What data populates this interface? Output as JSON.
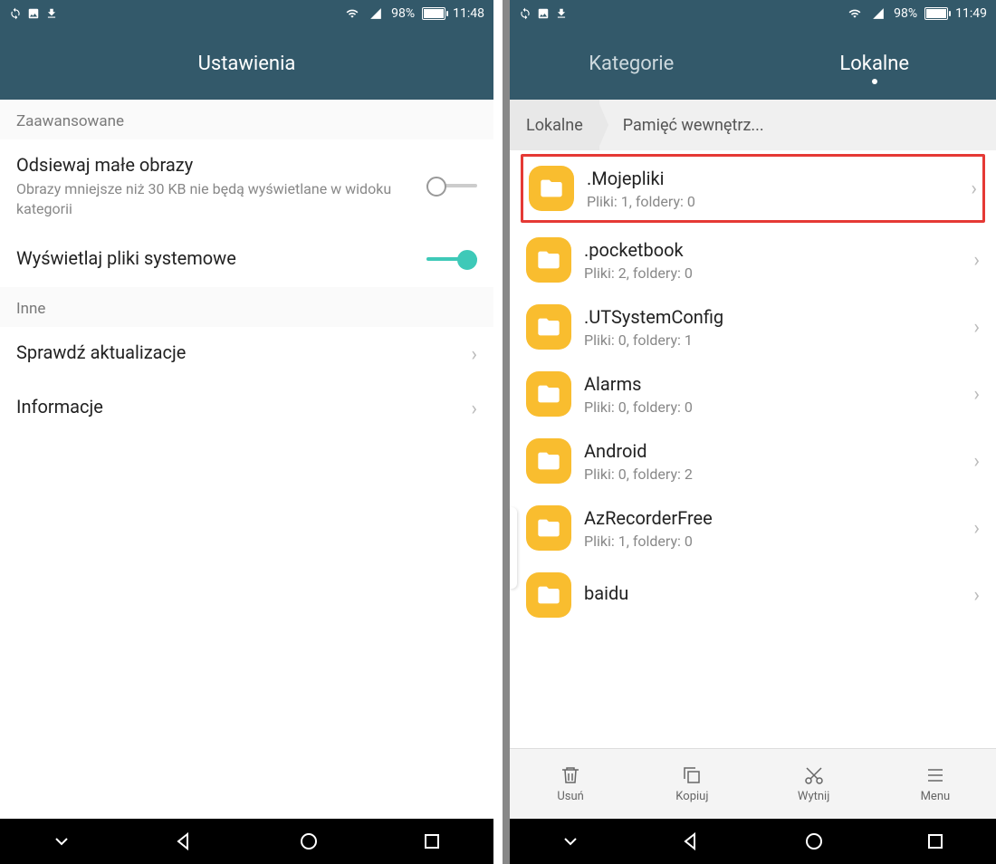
{
  "left": {
    "status": {
      "battery": "98%",
      "time": "11:48"
    },
    "title": "Ustawienia",
    "sections": {
      "advanced_header": "Zaawansowane",
      "filter_small": {
        "title": "Odsiewaj małe obrazy",
        "sub": "Obrazy mniejsze niż 30 KB nie będą wyświetlane w widoku kategorii",
        "value": false
      },
      "show_system": {
        "title": "Wyświetlaj pliki systemowe",
        "value": true
      },
      "other_header": "Inne",
      "check_updates": "Sprawdź aktualizacje",
      "info": "Informacje"
    }
  },
  "right": {
    "status": {
      "battery": "98%",
      "time": "11:49"
    },
    "tabs": {
      "categories": "Kategorie",
      "local": "Lokalne"
    },
    "breadcrumb": {
      "a": "Lokalne",
      "b": "Pamięć wewnętrz..."
    },
    "folders": [
      {
        "name": ".Mojepliki",
        "sub": "Pliki: 1, foldery: 0",
        "highlight": true
      },
      {
        "name": ".pocketbook",
        "sub": "Pliki: 2, foldery: 0"
      },
      {
        "name": ".UTSystemConfig",
        "sub": "Pliki: 0, foldery: 1"
      },
      {
        "name": "Alarms",
        "sub": "Pliki: 0, foldery: 0"
      },
      {
        "name": "Android",
        "sub": "Pliki: 0, foldery: 2"
      },
      {
        "name": "AzRecorderFree",
        "sub": "Pliki: 1, foldery: 0"
      },
      {
        "name": "baidu",
        "sub": ""
      }
    ],
    "toolbar": {
      "delete": "Usuń",
      "copy": "Kopiuj",
      "cut": "Wytnij",
      "menu": "Menu"
    }
  }
}
